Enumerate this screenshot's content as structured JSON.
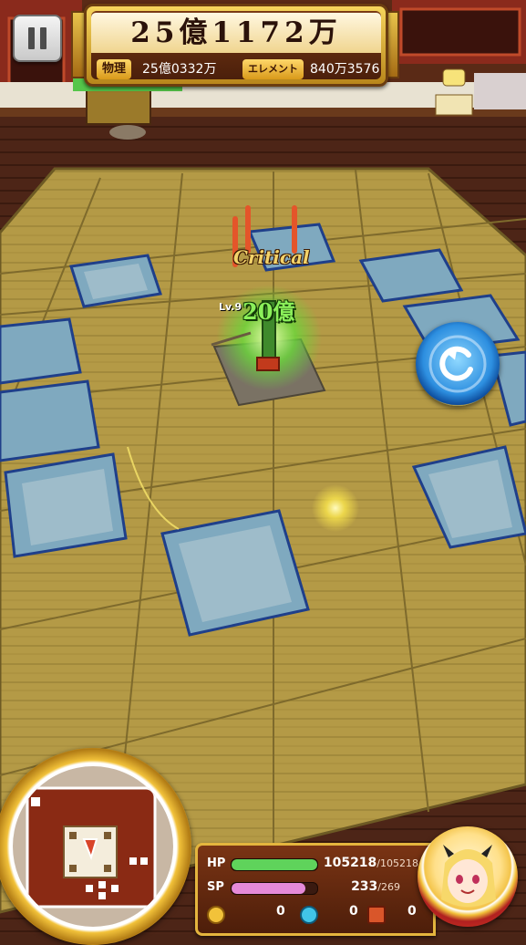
{
  "hud": {
    "pause_icon": "pause-icon",
    "damage_total": "25億1172万",
    "physical": {
      "label": "物理",
      "value": "25億0332万"
    },
    "element": {
      "label": "エレメント",
      "value": "840万3576"
    }
  },
  "battle": {
    "critical_text": "Critical",
    "enemy_level": "Lv.9",
    "hit_damage": "20億"
  },
  "retry_icon": "rotate-ccw-icon",
  "status": {
    "hp": {
      "label": "HP",
      "current": "105218",
      "max": "/105218",
      "fraction": 1.0,
      "color": "#5fd35b"
    },
    "sp": {
      "label": "SP",
      "current": "233",
      "max": "/269",
      "fraction": 0.866,
      "color": "#e58ad8"
    },
    "counters": [
      {
        "icon": "coin-icon",
        "value": "0",
        "color": "#f2c23a"
      },
      {
        "icon": "drop-icon",
        "value": "0",
        "color": "#41c4e8"
      },
      {
        "icon": "chest-icon",
        "value": "0",
        "color": "#d9562a"
      }
    ]
  },
  "colors": {
    "floor": "#4a2416",
    "tatami": "#b39a45",
    "tile_blue": "#7fa9bf",
    "gold": "#f2c23a"
  }
}
